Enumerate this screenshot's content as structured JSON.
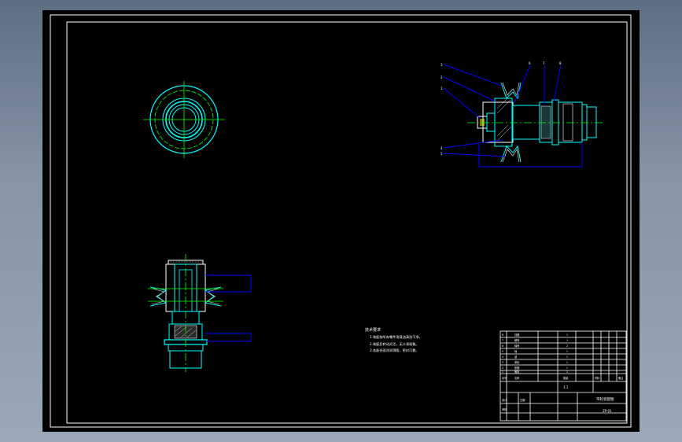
{
  "drawing": {
    "background": "#000000",
    "colors": {
      "frame": "#ffffff",
      "outline": "#00ffff",
      "centerline": "#00ff00",
      "leader": "#0000ff",
      "hatch": "#ffffff"
    },
    "balloons": [
      "3",
      "2",
      "1",
      "4",
      "5",
      "6",
      "7",
      "8"
    ],
    "notes": {
      "title": "技术要求",
      "lines": [
        "1.装配前所有零件用煤油清洗干净。",
        "2.装配后转动灵活，无卡滞现象。",
        "3.各配合面涂润滑脂，密封可靠。"
      ]
    },
    "title_block": {
      "parts": [
        {
          "no": "8",
          "name": "挡圈",
          "qty": "1"
        },
        {
          "no": "7",
          "name": "螺母",
          "qty": "1"
        },
        {
          "no": "6",
          "name": "轴承",
          "qty": "2"
        },
        {
          "no": "5",
          "name": "轴",
          "qty": "1"
        },
        {
          "no": "4",
          "name": "键",
          "qty": "1"
        },
        {
          "no": "3",
          "name": "带轮",
          "qty": "1"
        },
        {
          "no": "2",
          "name": "垫圈",
          "qty": "1"
        },
        {
          "no": "1",
          "name": "螺栓",
          "qty": "1"
        }
      ],
      "header": [
        "序号",
        "名称",
        "数量",
        "材料",
        "备注"
      ],
      "drawing_name": "带轮装配图",
      "scale": "1:1",
      "drawing_no": "ZP-01",
      "designer": "设计",
      "checker": "审核",
      "date": "日期"
    }
  }
}
